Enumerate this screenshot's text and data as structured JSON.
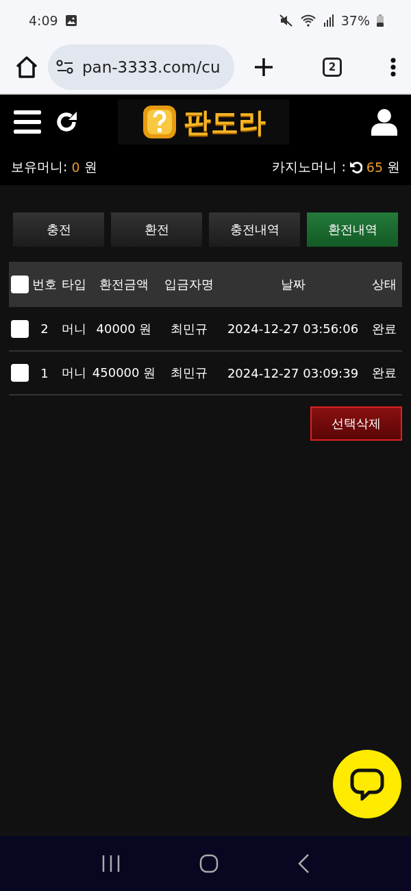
{
  "status_bar": {
    "time": "4:09",
    "battery": "37%"
  },
  "browser": {
    "url": "pan-3333.com/cu",
    "tab_count": "2"
  },
  "header": {
    "logo": "판도라"
  },
  "balances": [
    {
      "label": "보유머니:",
      "amount": "0",
      "unit": "원",
      "refresh": false
    },
    {
      "label": "카지노머니 :",
      "amount": "65",
      "unit": "원",
      "refresh": true
    }
  ],
  "tabs": [
    {
      "label": "충전",
      "selected": false
    },
    {
      "label": "환전",
      "selected": false
    },
    {
      "label": "충전내역",
      "selected": false
    },
    {
      "label": "환전내역",
      "selected": true
    }
  ],
  "table": {
    "select_all_checked": false,
    "columns": [
      "번호",
      "타입",
      "환전금액",
      "입금자명",
      "날짜",
      "상태"
    ],
    "rows": [
      {
        "checked": false,
        "cells": [
          "2",
          "머니",
          "40000 원",
          "최민규",
          "2024-12-27 03:56:06",
          "완료"
        ]
      },
      {
        "checked": false,
        "cells": [
          "1",
          "머니",
          "450000 원",
          "최민규",
          "2024-12-27 03:09:39",
          "완료"
        ]
      }
    ]
  },
  "delete_button": "선택삭제"
}
